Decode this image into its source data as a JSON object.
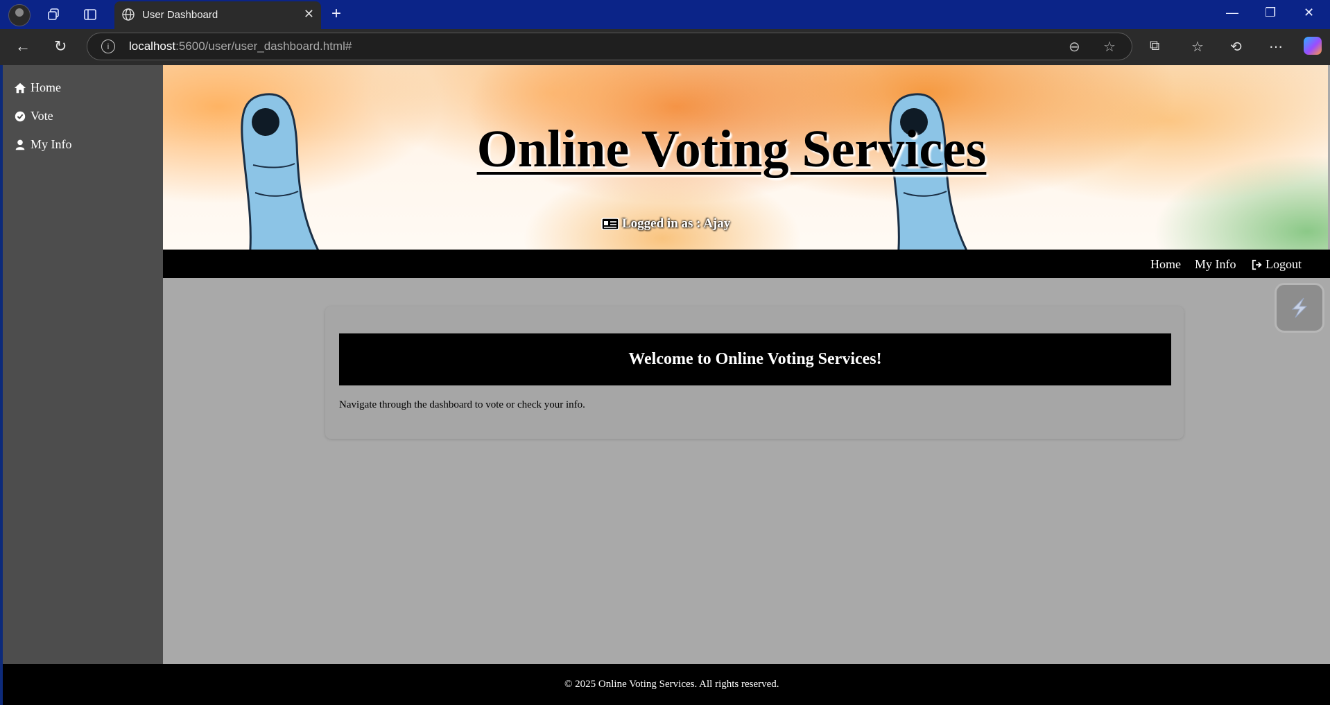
{
  "browser": {
    "tab_title": "User Dashboard",
    "url_host": "localhost",
    "url_path": ":5600/user/user_dashboard.html#"
  },
  "sidebar": {
    "items": [
      {
        "label": "Home",
        "icon": "home-icon"
      },
      {
        "label": "Vote",
        "icon": "check-circle-icon"
      },
      {
        "label": "My Info",
        "icon": "user-icon"
      }
    ]
  },
  "banner": {
    "title": "Online Voting Services",
    "logged_in": "Logged in as : Ajay"
  },
  "topnav": {
    "home": "Home",
    "my_info": "My Info",
    "logout": "Logout"
  },
  "main": {
    "welcome": "Welcome to Online Voting Services!",
    "description": "Navigate through the dashboard to vote or check your info."
  },
  "footer": {
    "text": "© 2025 Online Voting Services. All rights reserved."
  },
  "colors": {
    "sidebar": "#4d4d4d",
    "content_bg": "#a9a9a9",
    "nav_bg": "#000000",
    "tabbar": "#0b2488"
  }
}
